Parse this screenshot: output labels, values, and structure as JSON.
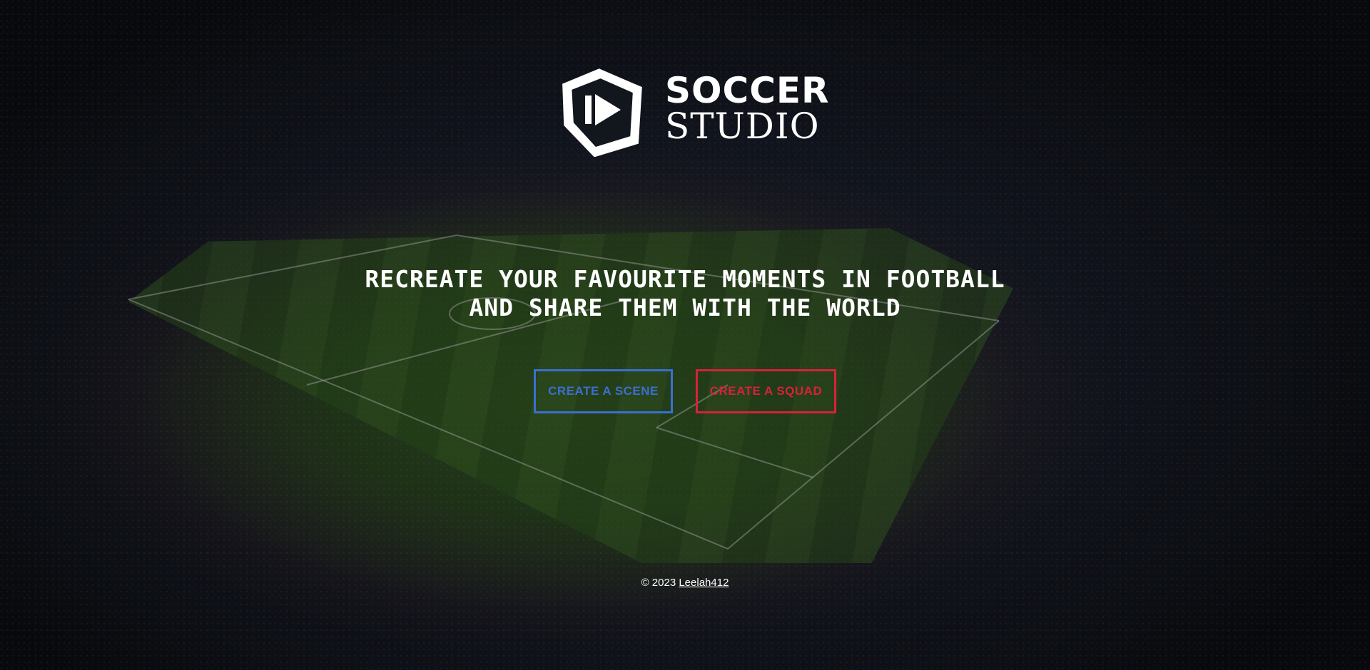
{
  "colors": {
    "scene_accent": "#3b6fd0",
    "squad_accent": "#d8213a",
    "text": "#ffffff"
  },
  "logo": {
    "icon": "play-pentagon-icon",
    "word_top": "SOCCER",
    "word_bottom": "STUDIO"
  },
  "hero": {
    "tagline_line_1": "RECREATE YOUR FAVOURITE MOMENTS IN FOOTBALL",
    "tagline_line_2": "AND SHARE THEM WITH THE WORLD"
  },
  "actions": {
    "create_scene_label": "CREATE A SCENE",
    "create_squad_label": "CREATE A SQUAD"
  },
  "footer": {
    "copyright": "© 2023",
    "author_link": "Leelah412"
  }
}
